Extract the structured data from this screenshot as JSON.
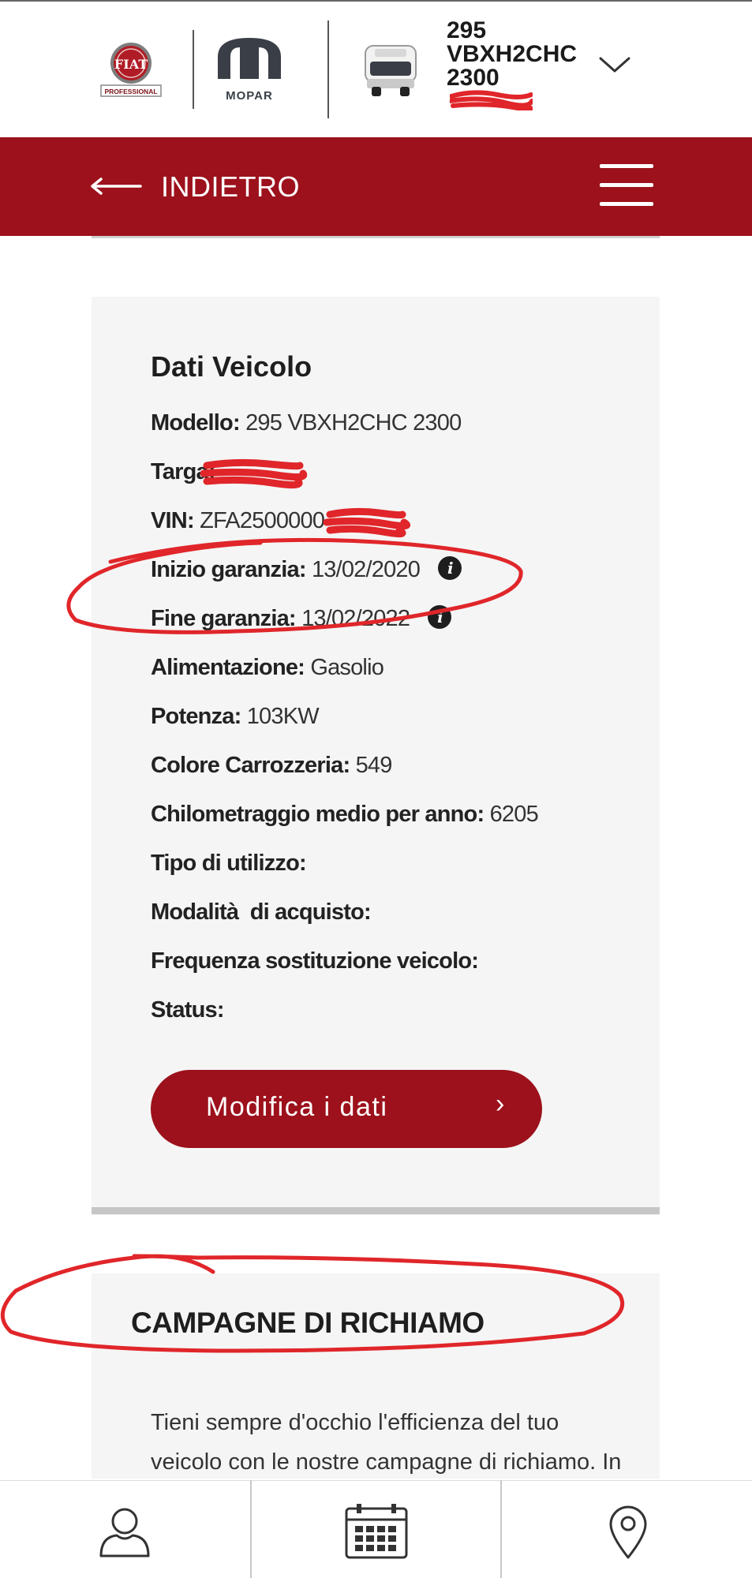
{
  "header": {
    "fiat_logo_text": "FIAT",
    "fiat_logo_sub": "PROFESSIONAL",
    "mopar_logo_text": "MOPAR",
    "vehicle_name": "295 VBXH2CHC 2300",
    "plate": "[redacted]"
  },
  "navbar": {
    "back_label": "INDIETRO"
  },
  "vehicle_card": {
    "title": "Dati Veicolo",
    "rows": [
      {
        "label": "Modello:",
        "value": "295 VBXH2CHC 2300"
      },
      {
        "label": "Targa:",
        "value": "[redacted]"
      },
      {
        "label": "VIN:",
        "value": "ZFA2500000[redacted]"
      },
      {
        "label": "Inizio garanzia:",
        "value": "13/02/2020"
      },
      {
        "label": "Fine garanzia:",
        "value": "13/02/2022"
      },
      {
        "label": "Alimentazione:",
        "value": "Gasolio"
      },
      {
        "label": "Potenza:",
        "value": "103KW"
      },
      {
        "label": "Colore Carrozzeria:",
        "value": "549"
      },
      {
        "label": "Chilometraggio medio per anno:",
        "value": "6205"
      },
      {
        "label": "Tipo di utilizzo:",
        "value": ""
      },
      {
        "label": "Modalità  di acquisto:",
        "value": ""
      },
      {
        "label": "Frequenza sostituzione veicolo:",
        "value": ""
      },
      {
        "label": "Status:",
        "value": ""
      }
    ],
    "button_label": "Modifica i dati",
    "button_chevron": "›"
  },
  "recall_card": {
    "title": "CAMPAGNE DI RICHIAMO",
    "text": "Tieni sempre d'occhio l'efficienza del tuo veicolo con le nostre campagne di richiamo. In"
  },
  "icons": {
    "info": "i",
    "tabs": [
      "user-icon",
      "calendar-icon",
      "location-pin-icon"
    ]
  },
  "colors": {
    "brand_red": "#9c111b",
    "annotation_red": "#e0262a",
    "card_bg": "#f5f5f5"
  }
}
